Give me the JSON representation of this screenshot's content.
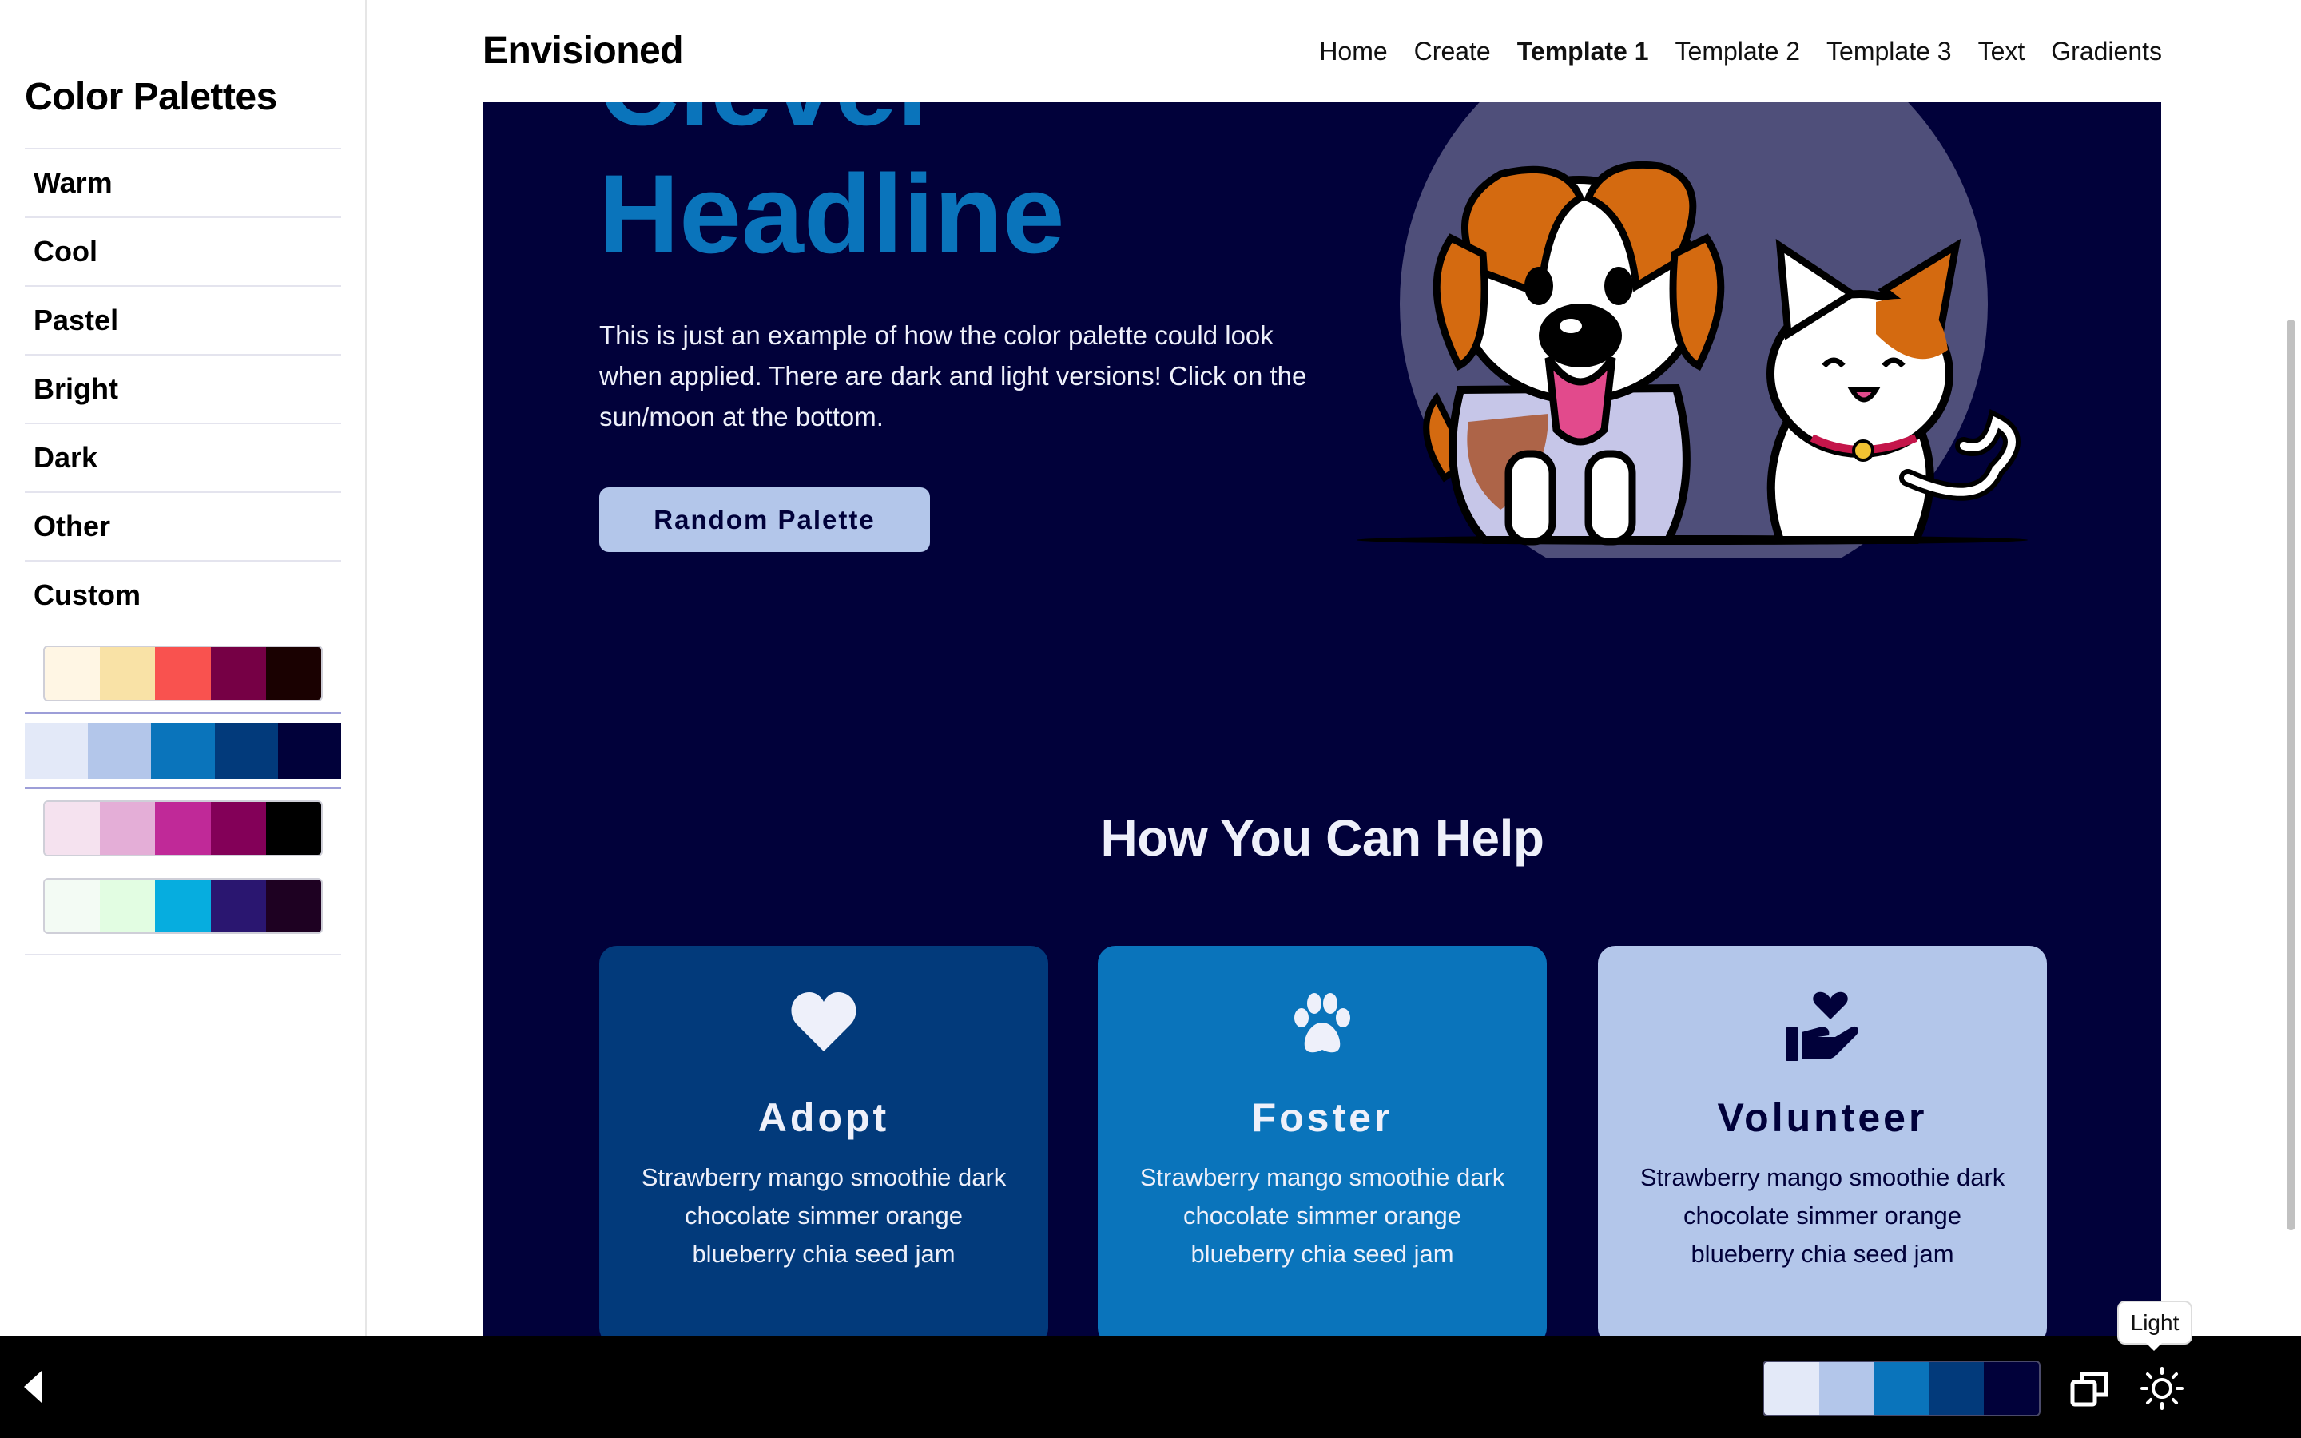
{
  "sidebar": {
    "title": "Color Palettes",
    "items": [
      {
        "label": "Warm"
      },
      {
        "label": "Cool"
      },
      {
        "label": "Pastel"
      },
      {
        "label": "Bright"
      },
      {
        "label": "Dark"
      },
      {
        "label": "Other"
      },
      {
        "label": "Custom"
      }
    ],
    "custom_palettes": [
      {
        "colors": [
          "#fff6e4",
          "#f9e2a6",
          "#f9524f",
          "#760045",
          "#1a0101"
        ],
        "selected": false
      },
      {
        "colors": [
          "#e3e9f8",
          "#b3c6ea",
          "#0a74bb",
          "#023a7b",
          "#01013a"
        ],
        "selected": true
      },
      {
        "colors": [
          "#f5e2ef",
          "#e4aed7",
          "#c02998",
          "#830058",
          "#000000"
        ],
        "selected": false
      },
      {
        "colors": [
          "#f3fbf4",
          "#e2fde2",
          "#06addf",
          "#2a1670",
          "#1e0122"
        ],
        "selected": false
      }
    ]
  },
  "header": {
    "brand": "Envisioned",
    "nav": [
      {
        "label": "Home",
        "active": false
      },
      {
        "label": "Create",
        "active": false
      },
      {
        "label": "Template 1",
        "active": true
      },
      {
        "label": "Template 2",
        "active": false
      },
      {
        "label": "Template 3",
        "active": false
      },
      {
        "label": "Text",
        "active": false
      },
      {
        "label": "Gradients",
        "active": false
      }
    ]
  },
  "hero": {
    "headline_line1": "Clever",
    "headline_line2": "Headline",
    "body": "This is just an example of how the color palette could look when applied. There are dark and light versions! Click on the sun/moon at the bottom.",
    "button_label": "Random Palette",
    "image_icon": "dog-and-cat-illustration"
  },
  "help": {
    "title": "How You Can Help",
    "cards": [
      {
        "icon": "heart-icon",
        "title": "Adopt",
        "text": "Strawberry mango smoothie dark chocolate simmer orange blueberry chia seed jam"
      },
      {
        "icon": "paw-icon",
        "title": "Foster",
        "text": "Strawberry mango smoothie dark chocolate simmer orange blueberry chia seed jam"
      },
      {
        "icon": "hand-heart-icon",
        "title": "Volunteer",
        "text": "Strawberry mango smoothie dark chocolate simmer orange blueberry chia seed jam"
      }
    ]
  },
  "bottom_bar": {
    "current_palette": [
      "#e3e9f8",
      "#b3c6ea",
      "#0a74bb",
      "#023a7b",
      "#01013a"
    ],
    "theme_tooltip": "Light",
    "icons": [
      "back-arrow-icon",
      "copy-icon",
      "sun-icon"
    ]
  },
  "theme": {
    "background": "#01013a",
    "accent": "#0a74bb",
    "light": "#b3c6ea",
    "text": "#eef0fa"
  }
}
